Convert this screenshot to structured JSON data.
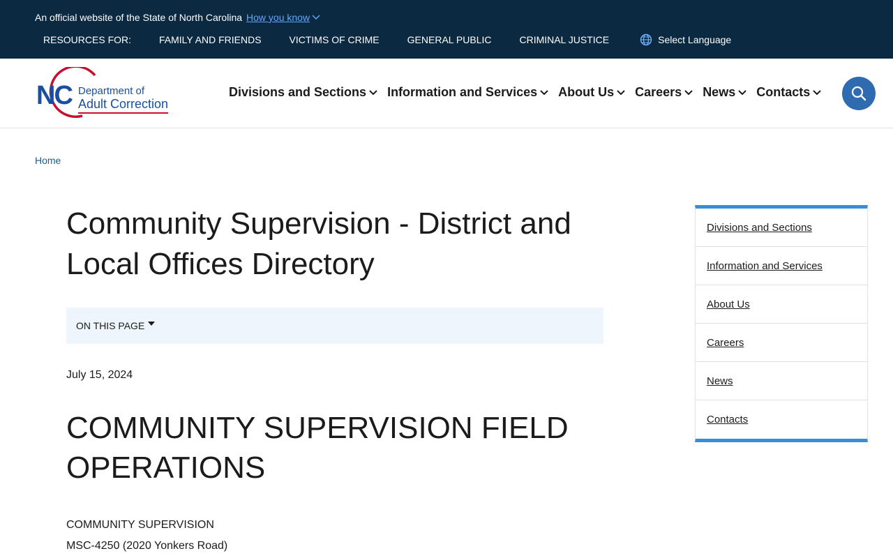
{
  "banner": {
    "official_text": "An official website of the State of North Carolina",
    "how_you_know": "How you know",
    "resources_label": "RESOURCES FOR:",
    "resources": [
      "FAMILY AND FRIENDS",
      "VICTIMS OF CRIME",
      "GENERAL PUBLIC",
      "CRIMINAL JUSTICE"
    ],
    "language": "Select Language"
  },
  "logo": {
    "nc": "NC",
    "line1": "Department of",
    "line2": "Adult Correction"
  },
  "nav": {
    "items": [
      "Divisions and Sections",
      "Information and Services",
      "About Us",
      "Careers",
      "News",
      "Contacts"
    ]
  },
  "breadcrumb": {
    "home": "Home"
  },
  "content": {
    "title": "Community Supervision - District and Local Offices Directory",
    "on_this_page": "ON THIS PAGE",
    "date": "July 15, 2024",
    "heading": "COMMUNITY SUPERVISION FIELD OPERATIONS",
    "address_line1": "COMMUNITY SUPERVISION",
    "address_line2": "MSC-4250 (2020 Yonkers Road)"
  },
  "sidenav": {
    "items": [
      "Divisions and Sections",
      "Information and Services",
      "About Us",
      "Careers",
      "News",
      "Contacts"
    ]
  },
  "colors": {
    "banner_bg": "#0b2941",
    "accent_blue": "#3a8ed6",
    "search_bg": "#2e6bb0",
    "logo_blue": "#1a4fa0",
    "logo_red": "#c8102e"
  }
}
